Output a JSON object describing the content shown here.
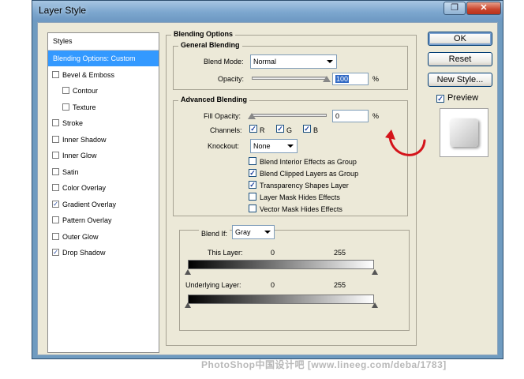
{
  "window": {
    "title": "Layer Style",
    "close_glyph": "✕",
    "restore_glyph": "❐"
  },
  "styles_panel": {
    "header": "Styles",
    "items": [
      {
        "label": "Blending Options: Custom",
        "checked": null,
        "selected": true
      },
      {
        "label": "Bevel & Emboss",
        "checked": false
      },
      {
        "label": "Contour",
        "checked": false,
        "indent": true
      },
      {
        "label": "Texture",
        "checked": false,
        "indent": true
      },
      {
        "label": "Stroke",
        "checked": false
      },
      {
        "label": "Inner Shadow",
        "checked": false
      },
      {
        "label": "Inner Glow",
        "checked": false
      },
      {
        "label": "Satin",
        "checked": false
      },
      {
        "label": "Color Overlay",
        "checked": false
      },
      {
        "label": "Gradient Overlay",
        "checked": true
      },
      {
        "label": "Pattern Overlay",
        "checked": false
      },
      {
        "label": "Outer Glow",
        "checked": false
      },
      {
        "label": "Drop Shadow",
        "checked": true
      }
    ]
  },
  "blending_options": {
    "title": "Blending Options",
    "general": {
      "title": "General Blending",
      "blend_mode_label": "Blend Mode:",
      "blend_mode_value": "Normal",
      "opacity_label": "Opacity:",
      "opacity_value": "100",
      "opacity_unit": "%",
      "opacity_level": 1.0
    },
    "advanced": {
      "title": "Advanced Blending",
      "fill_opacity_label": "Fill Opacity:",
      "fill_opacity_value": "0",
      "fill_opacity_unit": "%",
      "fill_opacity_level": 0.0,
      "channels_label": "Channels:",
      "channels": [
        {
          "label": "R",
          "checked": true
        },
        {
          "label": "G",
          "checked": true
        },
        {
          "label": "B",
          "checked": true
        }
      ],
      "knockout_label": "Knockout:",
      "knockout_value": "None",
      "options": [
        {
          "label": "Blend Interior Effects as Group",
          "checked": false
        },
        {
          "label": "Blend Clipped Layers as Group",
          "checked": true
        },
        {
          "label": "Transparency Shapes Layer",
          "checked": true
        },
        {
          "label": "Layer Mask Hides Effects",
          "checked": false
        },
        {
          "label": "Vector Mask Hides Effects",
          "checked": false
        }
      ]
    },
    "blend_if": {
      "label": "Blend If:",
      "value": "Gray",
      "this_layer_label": "This Layer:",
      "this_layer_min": "0",
      "this_layer_max": "255",
      "underlying_label": "Underlying Layer:",
      "underlying_min": "0",
      "underlying_max": "255"
    }
  },
  "buttons": {
    "ok": "OK",
    "reset": "Reset",
    "new_style": "New Style...",
    "preview_label": "Preview",
    "preview_checked": true
  },
  "watermark": "PhotoShop中国设计吧 [www.lineeg.com/deba/1783]",
  "colors": {
    "selection": "#3399ff",
    "annotation_arrow": "#d4141b",
    "dialog_bg": "#ece9d8"
  }
}
